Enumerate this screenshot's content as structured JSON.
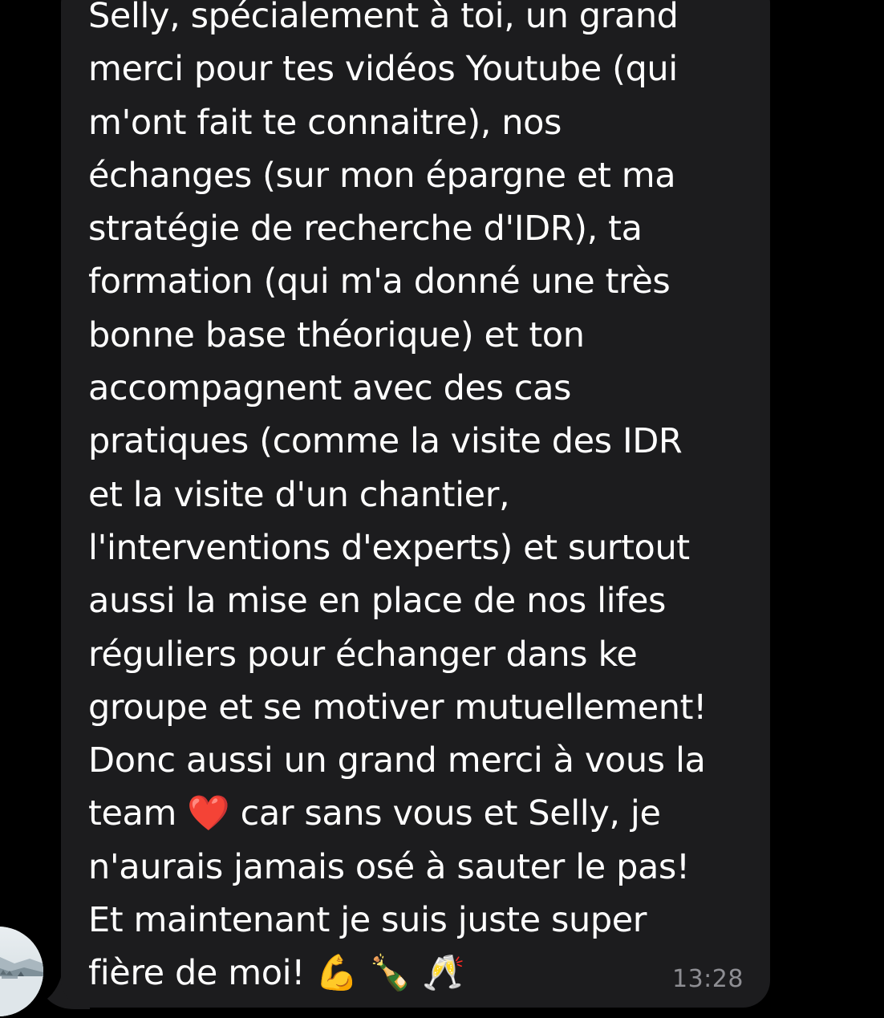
{
  "message": {
    "text": "Selly, spécialement à toi, un grand\nmerci pour tes vidéos Youtube (qui\nm'ont fait te connaitre), nos\néchanges (sur mon épargne et ma\nstratégie de recherche d'IDR), ta\nformation (qui m'a donné une très\nbonne base théorique) et ton\naccompagnent avec des cas\npratiques (comme la visite des IDR\net la visite d'un chantier,\nl'interventions d'experts) et surtout\naussi la mise en place de nos lifes\nréguliers pour échanger dans ke\ngroupe et se motiver mutuellement!\nDonc aussi un grand merci à vous la\nteam ❤️ car sans vous et Selly, je\nn'aurais jamais osé à sauter le pas!\nEt maintenant je suis juste super\nfière de moi! 💪 🍾 🥂",
    "time": "13:28"
  },
  "colors": {
    "background": "#000000",
    "bubble": "#1c1c1e",
    "text": "#ffffff",
    "timestamp": "#8e8e93"
  },
  "icons": {
    "avatar": "sender-avatar-snow-landscape"
  }
}
